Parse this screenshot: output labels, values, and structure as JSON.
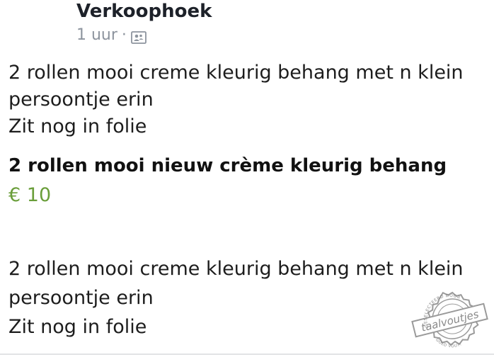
{
  "post": {
    "group_name": "Verkoophoek",
    "time": "1 uur",
    "separator": "·",
    "privacy_icon": "group-members-icon",
    "text_lines": [
      "2 rollen mooi creme kleurig behang met n klein",
      "persoontje erin",
      "Zit nog in folie"
    ]
  },
  "listing": {
    "title": "2 rollen mooi nieuw crème kleurig behang",
    "price": "€ 10",
    "price_color": "#6a9e3a",
    "description_lines": [
      "2 rollen mooi creme kleurig behang met n klein",
      "persoontje erin",
      "Zit nog in folie"
    ]
  },
  "watermark": {
    "top_text": "GESELECTEERD DOOR",
    "brand": "taalvoutjes",
    "bottom_text": "GOED VOUT!"
  }
}
